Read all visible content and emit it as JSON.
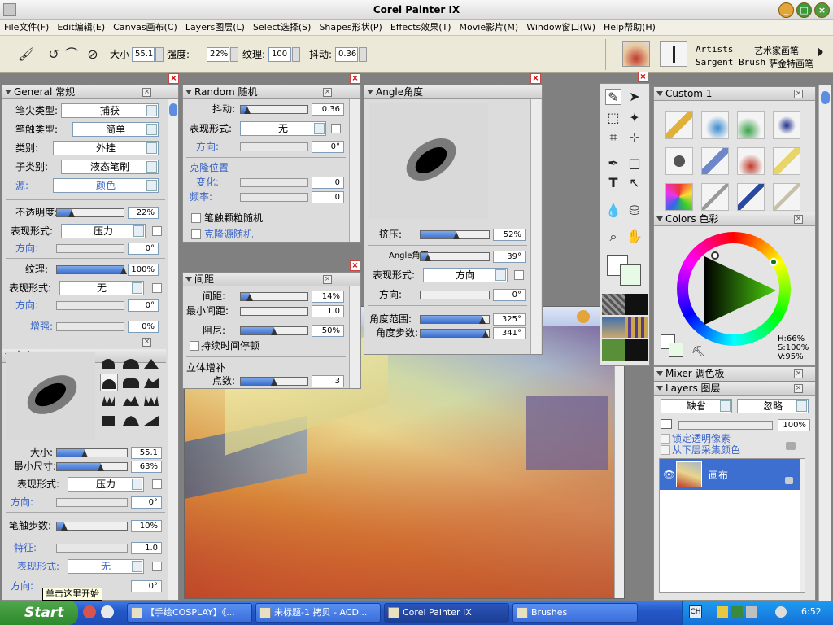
{
  "app": {
    "title": "Corel Painter IX"
  },
  "menu": [
    "File文件(F)",
    "Edit编辑(E)",
    "Canvas画布(C)",
    "Layers图层(L)",
    "Select选择(S)",
    "Shapes形状(P)",
    "Effects效果(T)",
    "Movie影片(M)",
    "Window窗口(W)",
    "Help帮助(H)"
  ],
  "toolbar": {
    "size_label": "大小",
    "size_value": "55.1",
    "opacity_label": "强度:",
    "opacity_value": "22%",
    "grain_label": "纹理:",
    "grain_value": "100",
    "jitter_label": "抖动:",
    "jitter_value": "0.36",
    "brush_category": "Artists",
    "brush_category_cn": "艺术家画笔",
    "brush_variant": "Sargent Brush",
    "brush_variant_cn": "萨金特画笔"
  },
  "general": {
    "title": "General 常规",
    "dab_type_label": "笔尖类型:",
    "dab_type": "捕获",
    "stroke_type_label": "笔触类型:",
    "stroke_type": "简单",
    "method_label": "类别:",
    "method": "外挂",
    "subcategory_label": "子类别:",
    "subcategory": "液态笔刷",
    "source_label": "源:",
    "source": "颜色",
    "opacity_label": "不透明度:",
    "opacity": "22%",
    "opacity_pct": 22,
    "expr_label": "表现形式:",
    "expr1": "压力",
    "dir_label": "方向:",
    "dir1": "0°",
    "grain_label": "纹理:",
    "grain": "100%",
    "grain_pct": 100,
    "expr2": "无",
    "dir2": "0°",
    "boost_label": "增强:",
    "boost": "0%"
  },
  "size": {
    "title": "大小",
    "size_label": "大小:",
    "size": "55.1",
    "size_pct": 40,
    "min_label": "最小尺寸:",
    "min": "63%",
    "min_pct": 63,
    "expr_label": "表现形式:",
    "expr": "压力",
    "dir_label": "方向:",
    "dir": "0°",
    "steps_label": "笔触步数:",
    "steps": "10%",
    "steps_pct": 10,
    "feature_label": "特征:",
    "feature": "1.0",
    "expr2": "无",
    "dir2": "0°"
  },
  "random": {
    "title": "Random 随机",
    "jitter_label": "抖动:",
    "jitter": "0.36",
    "jitter_pct": 10,
    "expr_label": "表现形式:",
    "expr": "无",
    "dir_label": "方向:",
    "dir": "0°",
    "clone_label": "克隆位置",
    "change_label": "变化:",
    "change": "0",
    "freq_label": "频率:",
    "freq": "0",
    "opt1": "笔触颗粒随机",
    "opt2": "克隆源随机"
  },
  "spacing": {
    "title": "间距",
    "spacing_label": "间距:",
    "spacing": "14%",
    "spacing_pct": 14,
    "min_label": "最小间距:",
    "min": "1.0",
    "damp_label": "阻尼:",
    "damp": "50%",
    "damp_pct": 50,
    "cont_label": "持续时间停顿",
    "stroke_label": "立体增补",
    "points_label": "点数:",
    "points": "3",
    "points_pct": 50
  },
  "angle": {
    "title": "Angle角度",
    "squeeze_label": "挤压:",
    "squeeze": "52%",
    "squeeze_pct": 52,
    "angle_label": "Angle角度",
    "angle": "39°",
    "angle_pct": 11,
    "expr_label": "表现形式:",
    "expr": "方向",
    "dir_label": "方向:",
    "dir": "0°",
    "range_label": "角度范围:",
    "range": "325°",
    "range_pct": 90,
    "step_label": "角度步数:",
    "step": "341°",
    "step_pct": 95
  },
  "custom": {
    "title": "Custom 1"
  },
  "colors": {
    "title": "Colors 色彩",
    "hue": "H:66%",
    "sat": "S:100%",
    "val": "V:95%"
  },
  "mixer": {
    "title": "Mixer 调色板"
  },
  "layers": {
    "title": "Layers 图层",
    "composite": "缺省",
    "method": "忽略",
    "opacity": "100%",
    "preserve": "锁定透明像素",
    "pick_under": "从下层采集颜色",
    "layer_name": "画布"
  },
  "tooltip": "单击这里开始",
  "taskbar": {
    "start": "Start",
    "items": [
      "【手绘COSPLAY】《...",
      "未标题-1 拷贝 - ACD...",
      "Corel Painter IX",
      "Brushes"
    ],
    "time": "6:52"
  }
}
